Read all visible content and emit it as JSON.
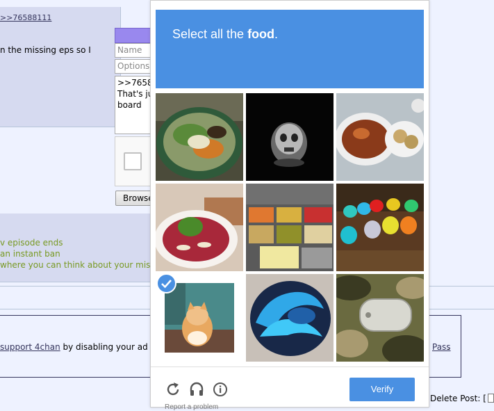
{
  "background_page": {
    "post1": {
      "quote_link": ">>76588111",
      "text": "n the missing eps so I"
    },
    "quick_reply": {
      "name_placeholder": "Name",
      "options_placeholder": "Options",
      "comment_lines": ">>76588\nThat's ju\nboard",
      "browse_label": "Browse"
    },
    "post2": {
      "line1": "v episode ends",
      "line2": "an instant ban",
      "line3": "where you can think about your mista"
    },
    "ad_notice": {
      "link_text": "support 4chan",
      "text_after": " by disabling your ad blo",
      "right_link": "Pass",
      "right_dot": "."
    },
    "delete_post_label": "Delete Post: ["
  },
  "captcha": {
    "prompt_prefix": "Select all the ",
    "prompt_target": "food",
    "prompt_suffix": ".",
    "tiles": [
      {
        "icon": "salad-bowl-image",
        "selected": false
      },
      {
        "icon": "skull-ring-image",
        "selected": false
      },
      {
        "icon": "soup-bowls-image",
        "selected": false
      },
      {
        "icon": "carpaccio-plate-image",
        "selected": false
      },
      {
        "icon": "buffet-trays-image",
        "selected": false
      },
      {
        "icon": "colorful-figurines-image",
        "selected": false
      },
      {
        "icon": "kitten-image",
        "selected": true
      },
      {
        "icon": "flame-helmet-image",
        "selected": false
      },
      {
        "icon": "dog-tag-camo-image",
        "selected": false
      }
    ],
    "verify_label": "Verify",
    "footer_text": "Report a problem",
    "accent_color": "#4a90e2"
  }
}
